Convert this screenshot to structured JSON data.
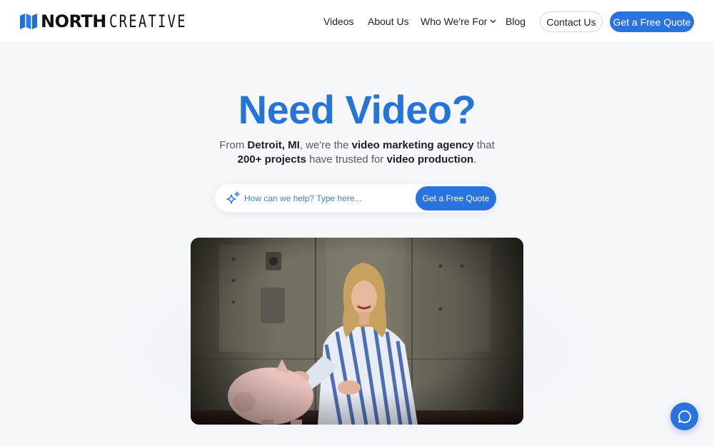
{
  "logo": {
    "bold": "NORTH",
    "thin": "CREATIVE"
  },
  "nav": {
    "videos": "Videos",
    "about": "About Us",
    "who": "Who We're For",
    "blog": "Blog",
    "contact": "Contact Us",
    "quote": "Get a Free Quote"
  },
  "hero": {
    "title": "Need Video?",
    "sub_1": "From ",
    "sub_2": "Detroit, MI",
    "sub_3": ", we're the ",
    "sub_4": "video marketing agency",
    "sub_5": " that ",
    "sub_6": "200+ projects",
    "sub_7": " have trusted for ",
    "sub_8": "video production",
    "sub_9": "."
  },
  "search": {
    "placeholder": "How can we help? Type here...",
    "button": "Get a Free Quote"
  },
  "icons": {
    "logo": "north-creative-logo-mark",
    "sparkle": "sparkle-icon",
    "chevron": "chevron-down-icon",
    "chat": "chat-bubble-icon"
  },
  "colors": {
    "accent": "#2a73de",
    "title": "#2474d9",
    "background": "#f6f7f9"
  }
}
